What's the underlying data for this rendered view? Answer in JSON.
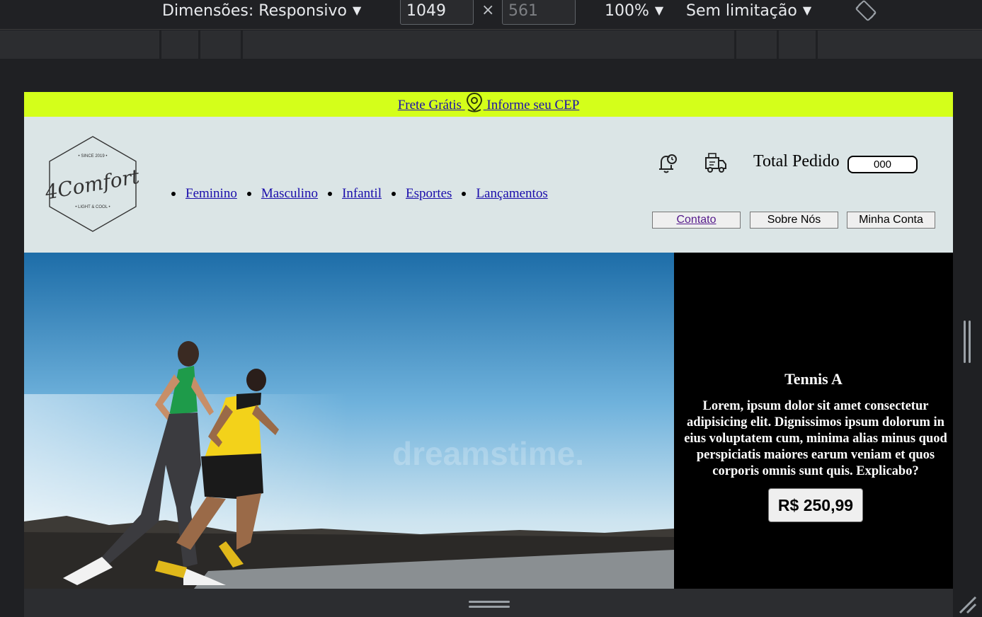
{
  "devtools": {
    "dimensions_label": "Dimensões: Responsivo",
    "width_value": "1049",
    "height_value": "561",
    "times_symbol": "×",
    "zoom_label": "100%",
    "throttle_label": "Sem limitação",
    "caret": "▼"
  },
  "promo": {
    "free_shipping": "Frete Grátis",
    "zip_link": "Informe seu CEP"
  },
  "header": {
    "logo_text": "4Comfort",
    "logo_since": "• SINCE 2019 •",
    "logo_tagline": "• LIGHT & COOL •",
    "nav": [
      "Feminino",
      "Masculino",
      "Infantil",
      "Esportes",
      "Lançamentos"
    ],
    "total_label": "Total Pedido",
    "total_value": "000",
    "buttons": {
      "contact": "Contato",
      "about": "Sobre Nós",
      "account": "Minha Conta"
    }
  },
  "hero": {
    "image_watermark": "dreamstime.",
    "product_name": "Tennis A",
    "product_desc": "Lorem, ipsum dolor sit amet consectetur adipisicing elit. Dignissimos ipsum dolorum in eius voluptatem cum, minima alias minus quod perspiciatis maiores earum veniam et quos corporis omnis sunt quis. Explicabo?",
    "price": "R$ 250,99"
  },
  "colors": {
    "promo_bg": "#d4ff1a",
    "header_bg": "#dbe5e6",
    "panel_bg": "#000000",
    "link": "#1a0dab"
  },
  "icons": [
    "pin-icon",
    "bell-clock-icon",
    "delivery-truck-icon",
    "rotate-icon"
  ]
}
